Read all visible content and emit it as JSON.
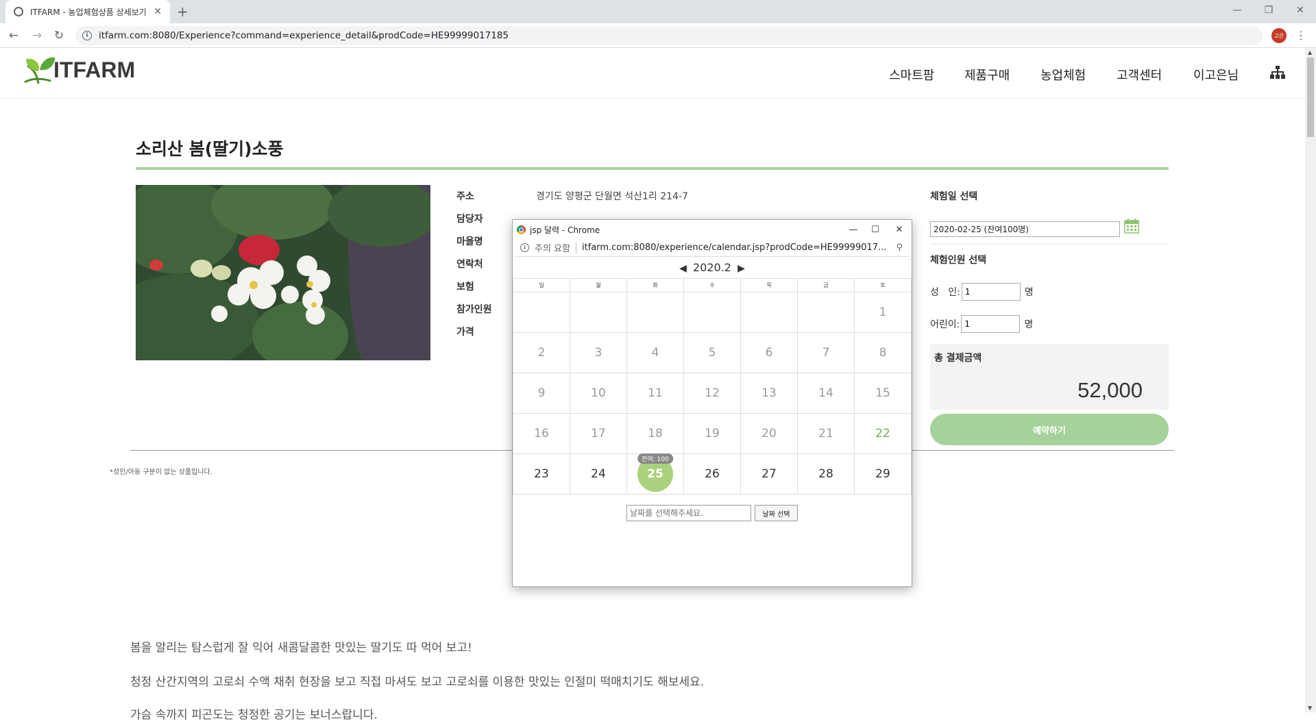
{
  "browser": {
    "tab_title": "ITFARM - 농업체험상품 상세보기",
    "url": "itfarm.com:8080/Experience?command=experience_detail&prodCode=HE99999017185",
    "avatar_text": "고은"
  },
  "site": {
    "logo_text": "ITFARM",
    "nav": [
      "스마트팜",
      "제품구매",
      "농업체험",
      "고객센터",
      "이고은님"
    ]
  },
  "product": {
    "title": "소리산 봄(딸기)소풍",
    "info": [
      {
        "label": "주소",
        "value": "경기도 양평군 단월면 석산1리 214-7"
      },
      {
        "label": "담당자",
        "value": ""
      },
      {
        "label": "마을명",
        "value": ""
      },
      {
        "label": "연락처",
        "value": ""
      },
      {
        "label": "보험",
        "value": ""
      },
      {
        "label": "참가인원",
        "value": ""
      },
      {
        "label": "가격",
        "value": ""
      }
    ],
    "notice": "*성인/아동 구분이 없는 상품입니다.",
    "description": [
      "봄을 알리는 탐스럽게 잘 익어 새콤달콤한 맛있는 딸기도 따 먹어 보고!",
      "청정 산간지역의 고로쇠 수액 채취 현장을 보고 직접 마셔도 보고 고로쇠를 이용한 맛있는 인절미 떡매치기도 해보세요.",
      "가슴 속까지 피곤도는 청정한 공기는 보너스랍니다."
    ]
  },
  "booking": {
    "date_label": "체험일 선택",
    "date_value": "2020-02-25 (잔여100명)",
    "people_label": "체험인원 선택",
    "adult_label": "성   인:",
    "adult_value": "1",
    "child_label": "어린이:",
    "child_value": "1",
    "unit": "명",
    "total_label": "총 결제금액",
    "total_amount": "52,000",
    "reserve_button": "예약하기"
  },
  "popup": {
    "window_title": "jsp 달력 - Chrome",
    "security_warning": "주의 요함",
    "url": "itfarm.com:8080/experience/calendar.jsp?prodCode=HE99999017...",
    "month_label": "2020.2",
    "weekdays": [
      "일",
      "월",
      "화",
      "수",
      "목",
      "금",
      "토"
    ],
    "weeks": [
      [
        "",
        "",
        "",
        "",
        "",
        "",
        "1"
      ],
      [
        "2",
        "3",
        "4",
        "5",
        "6",
        "7",
        "8"
      ],
      [
        "9",
        "10",
        "11",
        "12",
        "13",
        "14",
        "15"
      ],
      [
        "16",
        "17",
        "18",
        "19",
        "20",
        "21",
        "22"
      ],
      [
        "23",
        "24",
        "25",
        "26",
        "27",
        "28",
        "29"
      ]
    ],
    "selected_day": "25",
    "remain_badge": "잔여: 100",
    "date_placeholder": "날짜를 선택해주세요.",
    "select_button": "날짜 선택"
  },
  "colors": {
    "accent_green": "#a5d29b",
    "calendar_selected": "#a9d27c",
    "title_rule": "#a9d29a"
  }
}
